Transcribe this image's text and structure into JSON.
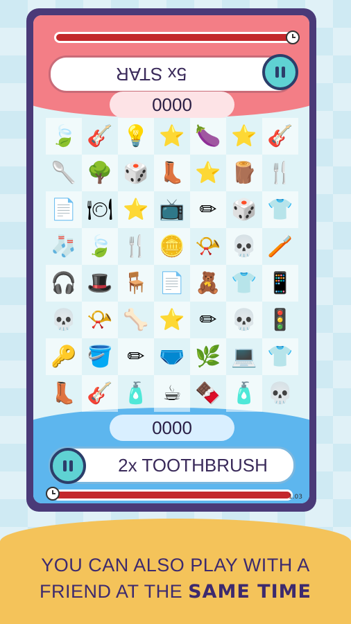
{
  "player_top": {
    "target_label": "5x STAR",
    "score": "0000"
  },
  "player_bottom": {
    "target_label": "2x TOOTHBRUSH",
    "score": "0000"
  },
  "version": "1.03",
  "caption": {
    "line1": "YOU CAN ALSO PLAY WITH A",
    "line2_plain": "FRIEND AT THE",
    "line2_bold": "SAME TIME"
  },
  "grid_items": [
    [
      "leaf",
      "guitar",
      "lightbulb",
      "star",
      "eggplant",
      "star",
      "guitar"
    ],
    [
      "spoon",
      "tree",
      "die",
      "boot",
      "star",
      "stump",
      "fork"
    ],
    [
      "paper",
      "plate",
      "star",
      "tv",
      "pencil",
      "die",
      "shirt"
    ],
    [
      "sock",
      "leaf",
      "fork",
      "coin",
      "cone",
      "skull",
      "toothpaste"
    ],
    [
      "headphones",
      "hat",
      "chair",
      "paper",
      "toy",
      "shirt",
      "phone"
    ],
    [
      "skull",
      "cone",
      "bone",
      "star",
      "pencil",
      "skull",
      "traffic-light"
    ],
    [
      "key",
      "bucket",
      "pencil",
      "underwear",
      "bush",
      "tablet",
      "shirt"
    ],
    [
      "boot",
      "guitar",
      "bottle",
      "cup",
      "chocolate",
      "bottle",
      "skull"
    ]
  ],
  "icons": {
    "leaf": "🍃",
    "guitar": "🎸",
    "lightbulb": "💡",
    "star": "⭐",
    "eggplant": "🍆",
    "spoon": "🥄",
    "tree": "🌳",
    "die": "🎲",
    "boot": "👢",
    "stump": "🪵",
    "fork": "🍴",
    "paper": "📄",
    "plate": "🍽",
    "tv": "📺",
    "pencil": "✏",
    "shirt": "👕",
    "sock": "🧦",
    "coin": "🪙",
    "cone": "📯",
    "skull": "💀",
    "toothpaste": "🪥",
    "headphones": "🎧",
    "hat": "🎩",
    "chair": "🪑",
    "toy": "🧸",
    "phone": "📱",
    "bone": "🦴",
    "traffic-light": "🚦",
    "key": "🔑",
    "bucket": "🪣",
    "underwear": "🩲",
    "bush": "🌿",
    "tablet": "💻",
    "bottle": "🧴",
    "cup": "☕",
    "chocolate": "🍫"
  }
}
